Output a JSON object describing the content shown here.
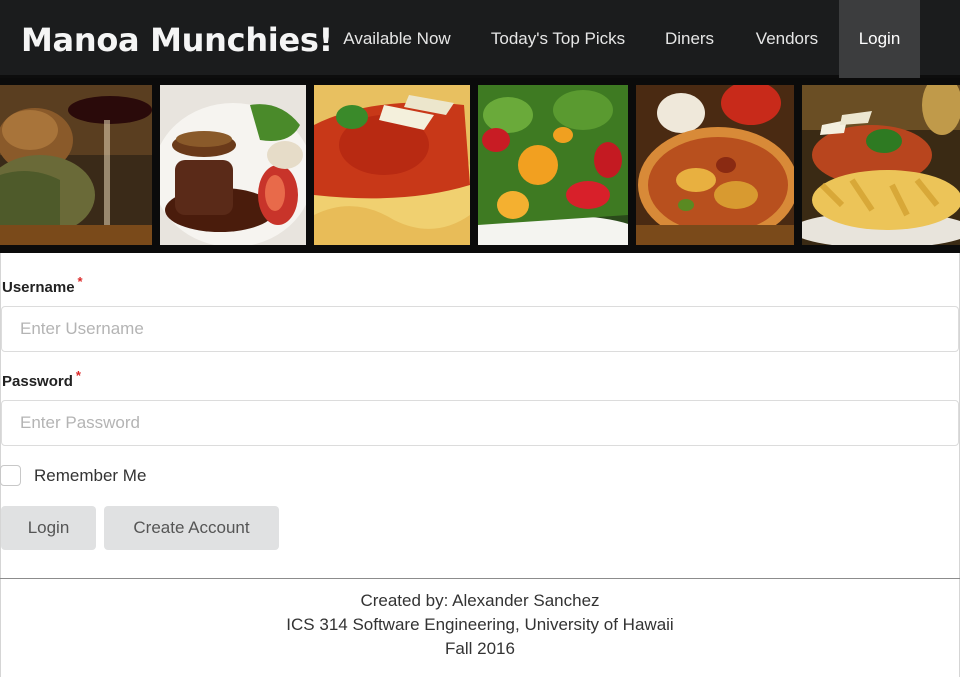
{
  "navbar": {
    "brand": "Manoa Munchies!",
    "items": [
      {
        "label": "Available Now",
        "active": false
      },
      {
        "label": "Today's Top Picks",
        "active": false
      },
      {
        "label": "Diners",
        "active": false
      },
      {
        "label": "Vendors",
        "active": false
      },
      {
        "label": "Login",
        "active": true
      }
    ]
  },
  "banner": {
    "photos": [
      "bread-and-wine",
      "steak-with-vegetables",
      "spaghetti-with-sauce",
      "strawberry-salad",
      "pizza",
      "penne-pasta"
    ]
  },
  "form": {
    "username": {
      "label": "Username",
      "required_mark": "*",
      "placeholder": "Enter Username",
      "value": ""
    },
    "password": {
      "label": "Password",
      "required_mark": "*",
      "placeholder": "Enter Password",
      "value": ""
    },
    "remember_me": {
      "label": "Remember Me",
      "checked": false
    },
    "buttons": {
      "login": "Login",
      "create_account": "Create Account"
    }
  },
  "footer": {
    "line1": "Created by: Alexander Sanchez",
    "line2": "ICS 314 Software Engineering, University of Hawaii",
    "line3": "Fall 2016"
  },
  "colors": {
    "navbar_bg": "#1b1c1d",
    "navbar_active": "#3c3d3e",
    "required": "#db2828",
    "button_bg": "#e0e1e2"
  }
}
